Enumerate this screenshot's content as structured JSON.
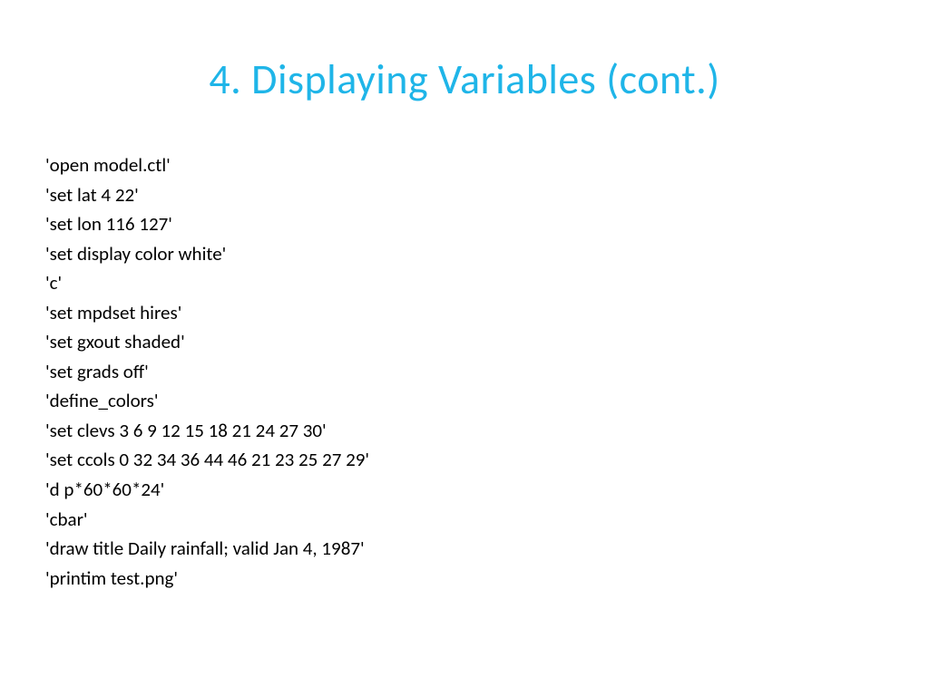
{
  "slide": {
    "title": "4. Displaying Variables (cont.)",
    "lines": [
      "'open model.ctl'",
      "'set lat 4 22'",
      "'set lon 116 127'",
      "'set display color white'",
      "'c'",
      "'set mpdset hires'",
      "'set gxout shaded'",
      "'set grads off'",
      "'define_colors'",
      "'set clevs 3 6 9 12 15 18 21 24 27 30'",
      "'set ccols 0 32 34 36 44 46 21 23 25 27 29'",
      "'d p*60*60*24'",
      "'cbar'",
      "'draw title Daily rainfall; valid Jan 4, 1987'",
      "'printim test.png'"
    ]
  }
}
